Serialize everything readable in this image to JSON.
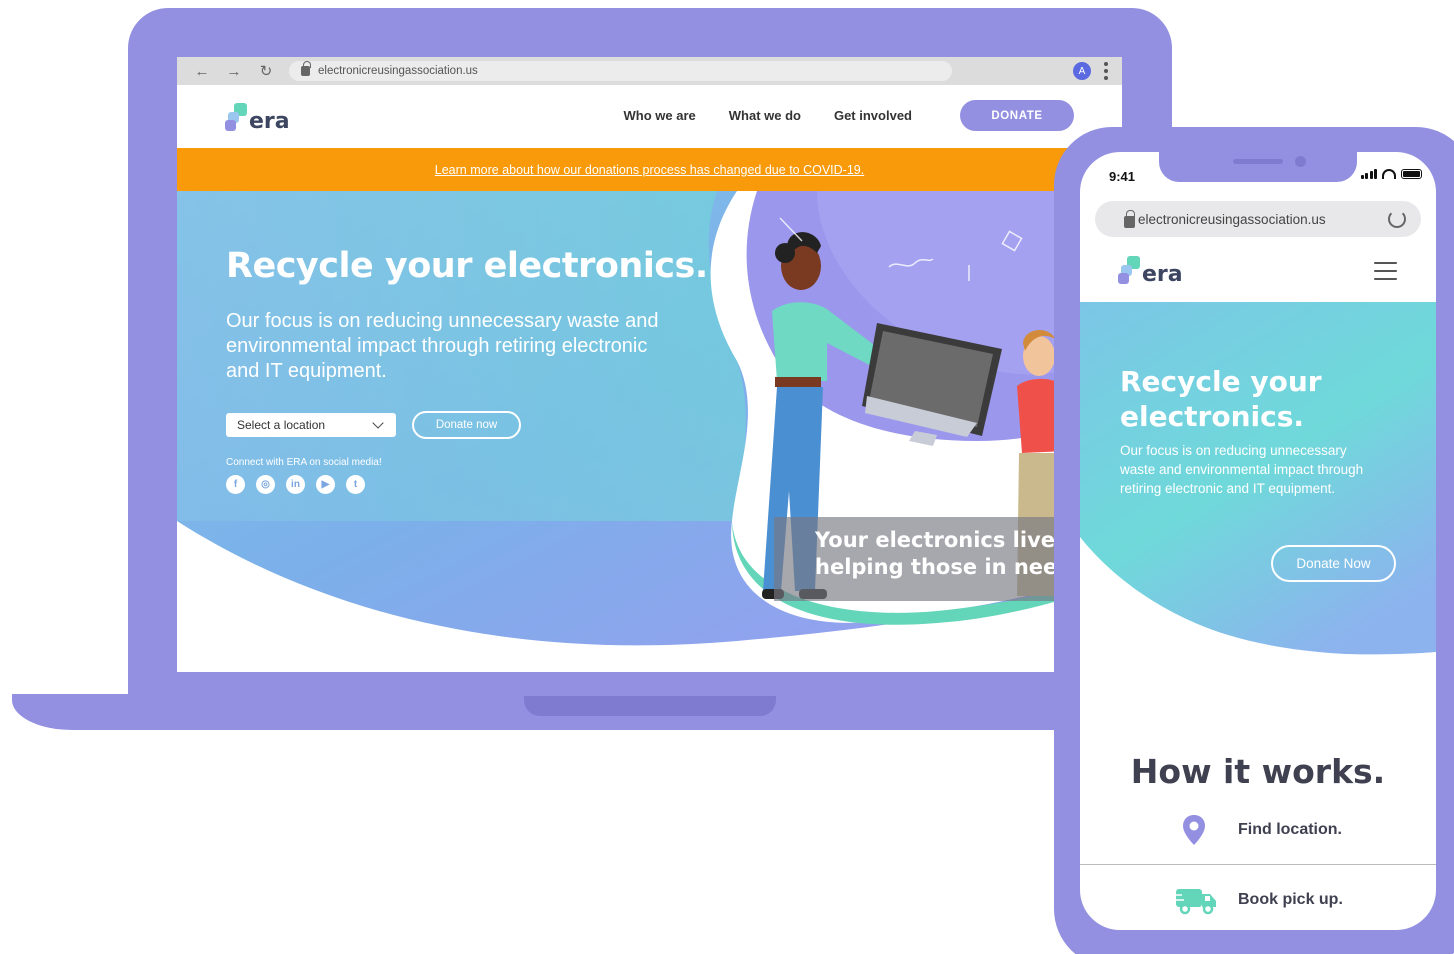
{
  "browser": {
    "url": "electronicreusingassociation.us",
    "profile_initial": "A",
    "back_glyph": "←",
    "forward_glyph": "→",
    "reload_glyph": "↻"
  },
  "site": {
    "logo_text": "era",
    "nav": [
      "Who we are",
      "What we do",
      "Get involved"
    ],
    "donate_label": "DONATE",
    "banner_text": "Learn more about how our donations process has changed due to COVID-19.",
    "hero": {
      "title": "Recycle your electronics.",
      "subtitle": "Our focus is on reducing unnecessary waste and environmental impact through retiring electronic and IT equipment.",
      "location_select": "Select a location",
      "donate_now": "Donate now",
      "connect_text": "Connect with ERA on social media!",
      "socials": [
        "f",
        "◎",
        "in",
        "▶",
        "t"
      ],
      "caption_line1": "Your electronics live o",
      "caption_line2": "helping those in need"
    }
  },
  "phone": {
    "time": "9:41",
    "url": "electronicreusingassociation.us",
    "logo_text": "era",
    "hero_title": "Recycle your electronics.",
    "hero_subtitle": "Our focus is on reducing unnecessary waste and environmental impact through retiring electronic and IT equipment.",
    "donate_label": "Donate Now",
    "how_title": "How it works.",
    "steps": [
      "Find location.",
      "Book pick up."
    ]
  },
  "colors": {
    "brand_purple": "#9390e1",
    "banner_orange": "#f99a0a",
    "hero_teal": "#6fdbd6",
    "hero_blue": "#7bb0ea",
    "hero_violet": "#a29ff0",
    "truck_green": "#63d5b9"
  }
}
